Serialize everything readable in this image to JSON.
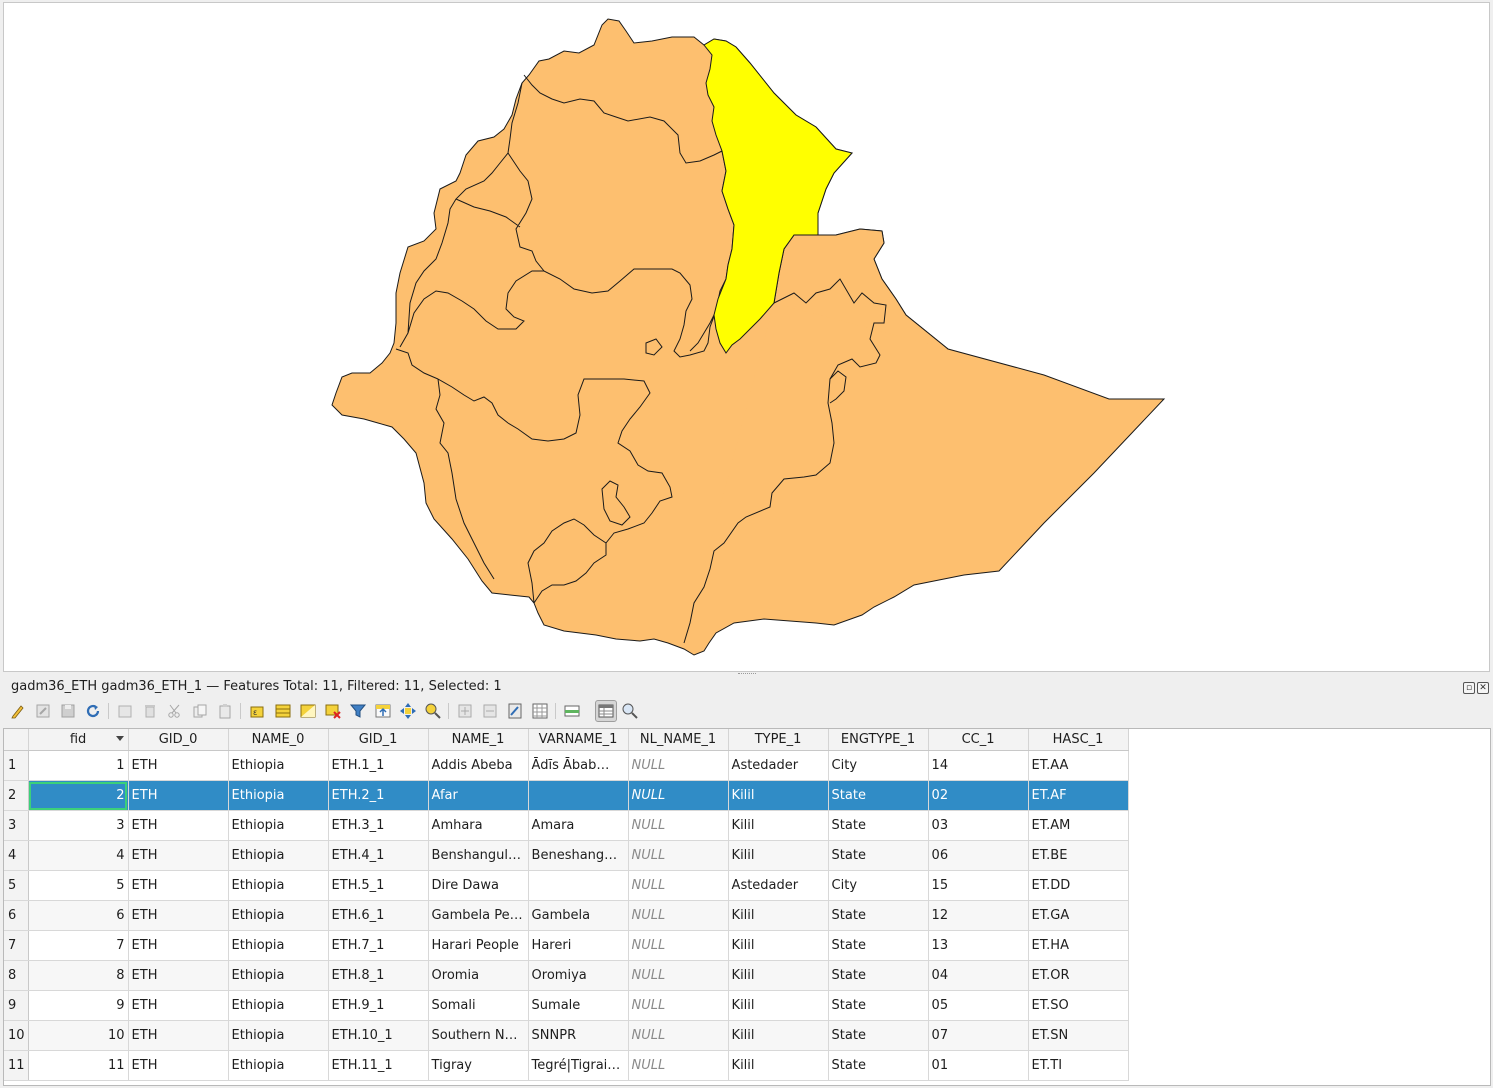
{
  "layer_panel": {
    "title": "gadm36_ETH gadm36_ETH_1 — Features Total: 11, Filtered: 11, Selected: 1"
  },
  "map": {
    "fill_color": "#fdbf6f",
    "selected_color": "#ffff00",
    "stroke_color": "#1a1a1a",
    "selected_feature": "Afar"
  },
  "toolbar": {
    "icons": [
      "toggle-editing-icon",
      "multi-edit-icon",
      "save-edits-icon",
      "reload-table-icon",
      "add-feature-icon",
      "delete-feature-icon",
      "cut-icon",
      "copy-icon",
      "paste-icon",
      "select-by-expression-icon",
      "select-all-icon",
      "invert-selection-icon",
      "deselect-all-icon",
      "filter-select-icon",
      "move-selection-top-icon",
      "pan-to-selected-icon",
      "zoom-to-selected-icon",
      "new-field-icon",
      "delete-field-icon",
      "field-calculator-icon",
      "conditional-formatting-icon",
      "actions-icon",
      "table-view-icon",
      "form-view-icon"
    ]
  },
  "table": {
    "columns": [
      "fid",
      "GID_0",
      "NAME_0",
      "GID_1",
      "NAME_1",
      "VARNAME_1",
      "NL_NAME_1",
      "TYPE_1",
      "ENGTYPE_1",
      "CC_1",
      "HASC_1"
    ],
    "sorted_column": "fid",
    "null_text": "NULL",
    "selected_row": 2,
    "rows": [
      {
        "row": "1",
        "cells": [
          "1",
          "ETH",
          "Ethiopia",
          "ETH.1_1",
          "Addis Abeba",
          "Ādīs Ābab…",
          "NULL",
          "Astedader",
          "City",
          "14",
          "ET.AA"
        ]
      },
      {
        "row": "2",
        "cells": [
          "2",
          "ETH",
          "Ethiopia",
          "ETH.2_1",
          "Afar",
          "",
          "NULL",
          "Kilil",
          "State",
          "02",
          "ET.AF"
        ]
      },
      {
        "row": "3",
        "cells": [
          "3",
          "ETH",
          "Ethiopia",
          "ETH.3_1",
          "Amhara",
          "Amara",
          "NULL",
          "Kilil",
          "State",
          "03",
          "ET.AM"
        ]
      },
      {
        "row": "4",
        "cells": [
          "4",
          "ETH",
          "Ethiopia",
          "ETH.4_1",
          "Benshangul…",
          "Beneshang…",
          "NULL",
          "Kilil",
          "State",
          "06",
          "ET.BE"
        ]
      },
      {
        "row": "5",
        "cells": [
          "5",
          "ETH",
          "Ethiopia",
          "ETH.5_1",
          "Dire Dawa",
          "",
          "NULL",
          "Astedader",
          "City",
          "15",
          "ET.DD"
        ]
      },
      {
        "row": "6",
        "cells": [
          "6",
          "ETH",
          "Ethiopia",
          "ETH.6_1",
          "Gambela Pe…",
          "Gambela",
          "NULL",
          "Kilil",
          "State",
          "12",
          "ET.GA"
        ]
      },
      {
        "row": "7",
        "cells": [
          "7",
          "ETH",
          "Ethiopia",
          "ETH.7_1",
          "Harari People",
          "Hareri",
          "NULL",
          "Kilil",
          "State",
          "13",
          "ET.HA"
        ]
      },
      {
        "row": "8",
        "cells": [
          "8",
          "ETH",
          "Ethiopia",
          "ETH.8_1",
          "Oromia",
          "Oromiya",
          "NULL",
          "Kilil",
          "State",
          "04",
          "ET.OR"
        ]
      },
      {
        "row": "9",
        "cells": [
          "9",
          "ETH",
          "Ethiopia",
          "ETH.9_1",
          "Somali",
          "Sumale",
          "NULL",
          "Kilil",
          "State",
          "05",
          "ET.SO"
        ]
      },
      {
        "row": "10",
        "cells": [
          "10",
          "ETH",
          "Ethiopia",
          "ETH.10_1",
          "Southern N…",
          "SNNPR",
          "NULL",
          "Kilil",
          "State",
          "07",
          "ET.SN"
        ]
      },
      {
        "row": "11",
        "cells": [
          "11",
          "ETH",
          "Ethiopia",
          "ETH.11_1",
          "Tigray",
          "Tegré|Tigrai…",
          "NULL",
          "Kilil",
          "State",
          "01",
          "ET.TI"
        ]
      }
    ]
  }
}
